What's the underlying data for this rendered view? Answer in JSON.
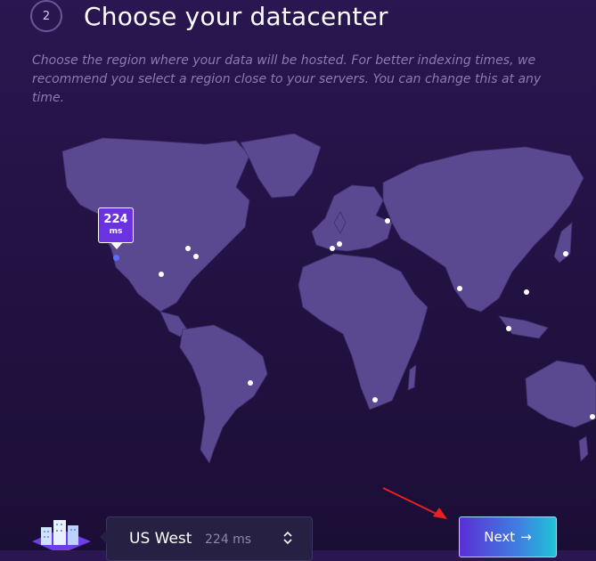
{
  "step": {
    "number": "2",
    "title": "Choose your datacenter"
  },
  "subtitle": "Choose the region where your data will be hosted. For better indexing times, we recommend you select a region close to your servers. You can change this at any time.",
  "map": {
    "tooltip": {
      "value": "224",
      "unit": "ms"
    },
    "icons": {
      "tooltip": "latency-tooltip",
      "dot": "datacenter-dot"
    }
  },
  "region": {
    "name": "US West",
    "latency": "224 ms"
  },
  "next_button": {
    "label": "Next",
    "arrow": "→"
  },
  "colors": {
    "background": "#231244",
    "land": "#5a4891",
    "accent": "#6b33e0",
    "button_gradient": [
      "#5a2fd6",
      "#1fc3d8"
    ],
    "annotation_arrow": "#e8201f"
  }
}
